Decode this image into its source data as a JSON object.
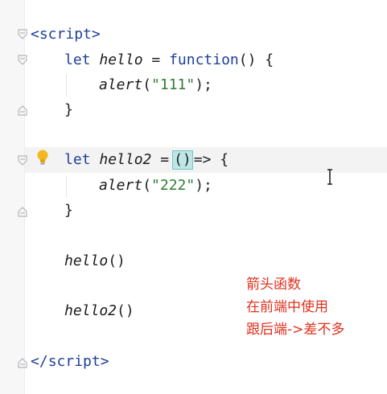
{
  "editor": {
    "lines": [
      {
        "id": "l1",
        "tokens": [
          {
            "t": "<",
            "c": "tag"
          },
          {
            "t": "script",
            "c": "tag"
          },
          {
            "t": ">",
            "c": "tag"
          }
        ]
      },
      {
        "id": "l2",
        "tokens": [
          {
            "t": "let ",
            "c": "kw"
          },
          {
            "t": "hello",
            "c": "it"
          },
          {
            "t": " = ",
            "c": ""
          },
          {
            "t": "function",
            "c": "kw"
          },
          {
            "t": "() {",
            "c": ""
          }
        ]
      },
      {
        "id": "l3",
        "tokens": [
          {
            "t": "alert",
            "c": "it"
          },
          {
            "t": "(",
            "c": ""
          },
          {
            "t": "\"111\"",
            "c": "str"
          },
          {
            "t": ");",
            "c": ""
          }
        ]
      },
      {
        "id": "l4",
        "tokens": [
          {
            "t": "}",
            "c": ""
          }
        ]
      },
      {
        "id": "l5",
        "tokens": [
          {
            "t": "let ",
            "c": "kw"
          },
          {
            "t": "hello2",
            "c": "it"
          },
          {
            "t": " =",
            "c": ""
          },
          {
            "t": "()",
            "c": "caret"
          },
          {
            "t": "=> {",
            "c": ""
          }
        ]
      },
      {
        "id": "l6",
        "tokens": [
          {
            "t": "alert",
            "c": "it"
          },
          {
            "t": "(",
            "c": ""
          },
          {
            "t": "\"222\"",
            "c": "str"
          },
          {
            "t": ");",
            "c": ""
          }
        ]
      },
      {
        "id": "l7",
        "tokens": [
          {
            "t": "}",
            "c": ""
          }
        ]
      },
      {
        "id": "l8",
        "tokens": [
          {
            "t": "hello",
            "c": "it"
          },
          {
            "t": "()",
            "c": ""
          }
        ]
      },
      {
        "id": "l9",
        "tokens": [
          {
            "t": "hello2",
            "c": "it"
          },
          {
            "t": "()",
            "c": ""
          }
        ]
      },
      {
        "id": "l10",
        "tokens": [
          {
            "t": "</",
            "c": "tag"
          },
          {
            "t": "script",
            "c": "tag"
          },
          {
            "t": ">",
            "c": "tag"
          }
        ]
      }
    ]
  },
  "annotation": {
    "line1": "箭头函数",
    "line2": "在前端中使用",
    "line3": "跟后端->差不多"
  },
  "icons": {
    "bulb": "lightbulb-icon",
    "cursor": "text-cursor-icon",
    "fold": "fold-marker-icon"
  },
  "colors": {
    "keyword": "#1f3f9a",
    "string": "#2f7d32",
    "annotation": "#e0301e",
    "caret_highlight": "#bfe6e6"
  }
}
